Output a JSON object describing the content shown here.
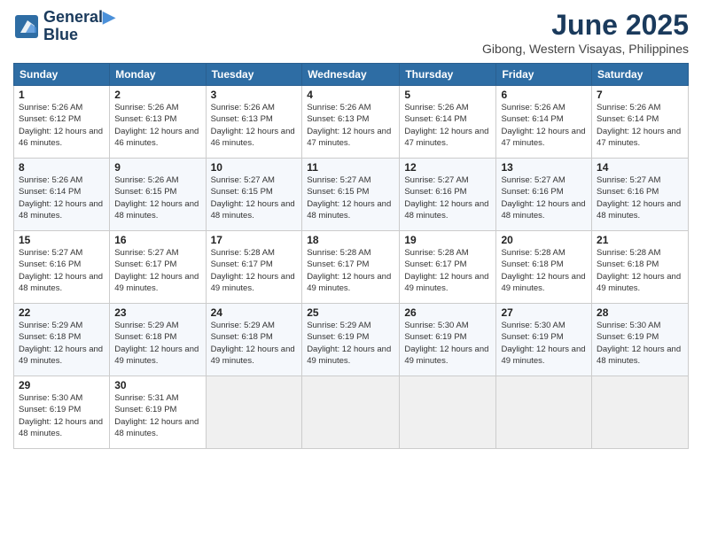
{
  "logo": {
    "line1": "General",
    "line2": "Blue"
  },
  "title": "June 2025",
  "subtitle": "Gibong, Western Visayas, Philippines",
  "days_header": [
    "Sunday",
    "Monday",
    "Tuesday",
    "Wednesday",
    "Thursday",
    "Friday",
    "Saturday"
  ],
  "weeks": [
    [
      {
        "day": "1",
        "sunrise": "Sunrise: 5:26 AM",
        "sunset": "Sunset: 6:12 PM",
        "daylight": "Daylight: 12 hours and 46 minutes."
      },
      {
        "day": "2",
        "sunrise": "Sunrise: 5:26 AM",
        "sunset": "Sunset: 6:13 PM",
        "daylight": "Daylight: 12 hours and 46 minutes."
      },
      {
        "day": "3",
        "sunrise": "Sunrise: 5:26 AM",
        "sunset": "Sunset: 6:13 PM",
        "daylight": "Daylight: 12 hours and 46 minutes."
      },
      {
        "day": "4",
        "sunrise": "Sunrise: 5:26 AM",
        "sunset": "Sunset: 6:13 PM",
        "daylight": "Daylight: 12 hours and 47 minutes."
      },
      {
        "day": "5",
        "sunrise": "Sunrise: 5:26 AM",
        "sunset": "Sunset: 6:14 PM",
        "daylight": "Daylight: 12 hours and 47 minutes."
      },
      {
        "day": "6",
        "sunrise": "Sunrise: 5:26 AM",
        "sunset": "Sunset: 6:14 PM",
        "daylight": "Daylight: 12 hours and 47 minutes."
      },
      {
        "day": "7",
        "sunrise": "Sunrise: 5:26 AM",
        "sunset": "Sunset: 6:14 PM",
        "daylight": "Daylight: 12 hours and 47 minutes."
      }
    ],
    [
      {
        "day": "8",
        "sunrise": "Sunrise: 5:26 AM",
        "sunset": "Sunset: 6:14 PM",
        "daylight": "Daylight: 12 hours and 48 minutes."
      },
      {
        "day": "9",
        "sunrise": "Sunrise: 5:26 AM",
        "sunset": "Sunset: 6:15 PM",
        "daylight": "Daylight: 12 hours and 48 minutes."
      },
      {
        "day": "10",
        "sunrise": "Sunrise: 5:27 AM",
        "sunset": "Sunset: 6:15 PM",
        "daylight": "Daylight: 12 hours and 48 minutes."
      },
      {
        "day": "11",
        "sunrise": "Sunrise: 5:27 AM",
        "sunset": "Sunset: 6:15 PM",
        "daylight": "Daylight: 12 hours and 48 minutes."
      },
      {
        "day": "12",
        "sunrise": "Sunrise: 5:27 AM",
        "sunset": "Sunset: 6:16 PM",
        "daylight": "Daylight: 12 hours and 48 minutes."
      },
      {
        "day": "13",
        "sunrise": "Sunrise: 5:27 AM",
        "sunset": "Sunset: 6:16 PM",
        "daylight": "Daylight: 12 hours and 48 minutes."
      },
      {
        "day": "14",
        "sunrise": "Sunrise: 5:27 AM",
        "sunset": "Sunset: 6:16 PM",
        "daylight": "Daylight: 12 hours and 48 minutes."
      }
    ],
    [
      {
        "day": "15",
        "sunrise": "Sunrise: 5:27 AM",
        "sunset": "Sunset: 6:16 PM",
        "daylight": "Daylight: 12 hours and 48 minutes."
      },
      {
        "day": "16",
        "sunrise": "Sunrise: 5:27 AM",
        "sunset": "Sunset: 6:17 PM",
        "daylight": "Daylight: 12 hours and 49 minutes."
      },
      {
        "day": "17",
        "sunrise": "Sunrise: 5:28 AM",
        "sunset": "Sunset: 6:17 PM",
        "daylight": "Daylight: 12 hours and 49 minutes."
      },
      {
        "day": "18",
        "sunrise": "Sunrise: 5:28 AM",
        "sunset": "Sunset: 6:17 PM",
        "daylight": "Daylight: 12 hours and 49 minutes."
      },
      {
        "day": "19",
        "sunrise": "Sunrise: 5:28 AM",
        "sunset": "Sunset: 6:17 PM",
        "daylight": "Daylight: 12 hours and 49 minutes."
      },
      {
        "day": "20",
        "sunrise": "Sunrise: 5:28 AM",
        "sunset": "Sunset: 6:18 PM",
        "daylight": "Daylight: 12 hours and 49 minutes."
      },
      {
        "day": "21",
        "sunrise": "Sunrise: 5:28 AM",
        "sunset": "Sunset: 6:18 PM",
        "daylight": "Daylight: 12 hours and 49 minutes."
      }
    ],
    [
      {
        "day": "22",
        "sunrise": "Sunrise: 5:29 AM",
        "sunset": "Sunset: 6:18 PM",
        "daylight": "Daylight: 12 hours and 49 minutes."
      },
      {
        "day": "23",
        "sunrise": "Sunrise: 5:29 AM",
        "sunset": "Sunset: 6:18 PM",
        "daylight": "Daylight: 12 hours and 49 minutes."
      },
      {
        "day": "24",
        "sunrise": "Sunrise: 5:29 AM",
        "sunset": "Sunset: 6:18 PM",
        "daylight": "Daylight: 12 hours and 49 minutes."
      },
      {
        "day": "25",
        "sunrise": "Sunrise: 5:29 AM",
        "sunset": "Sunset: 6:19 PM",
        "daylight": "Daylight: 12 hours and 49 minutes."
      },
      {
        "day": "26",
        "sunrise": "Sunrise: 5:30 AM",
        "sunset": "Sunset: 6:19 PM",
        "daylight": "Daylight: 12 hours and 49 minutes."
      },
      {
        "day": "27",
        "sunrise": "Sunrise: 5:30 AM",
        "sunset": "Sunset: 6:19 PM",
        "daylight": "Daylight: 12 hours and 49 minutes."
      },
      {
        "day": "28",
        "sunrise": "Sunrise: 5:30 AM",
        "sunset": "Sunset: 6:19 PM",
        "daylight": "Daylight: 12 hours and 48 minutes."
      }
    ],
    [
      {
        "day": "29",
        "sunrise": "Sunrise: 5:30 AM",
        "sunset": "Sunset: 6:19 PM",
        "daylight": "Daylight: 12 hours and 48 minutes."
      },
      {
        "day": "30",
        "sunrise": "Sunrise: 5:31 AM",
        "sunset": "Sunset: 6:19 PM",
        "daylight": "Daylight: 12 hours and 48 minutes."
      },
      null,
      null,
      null,
      null,
      null
    ]
  ]
}
